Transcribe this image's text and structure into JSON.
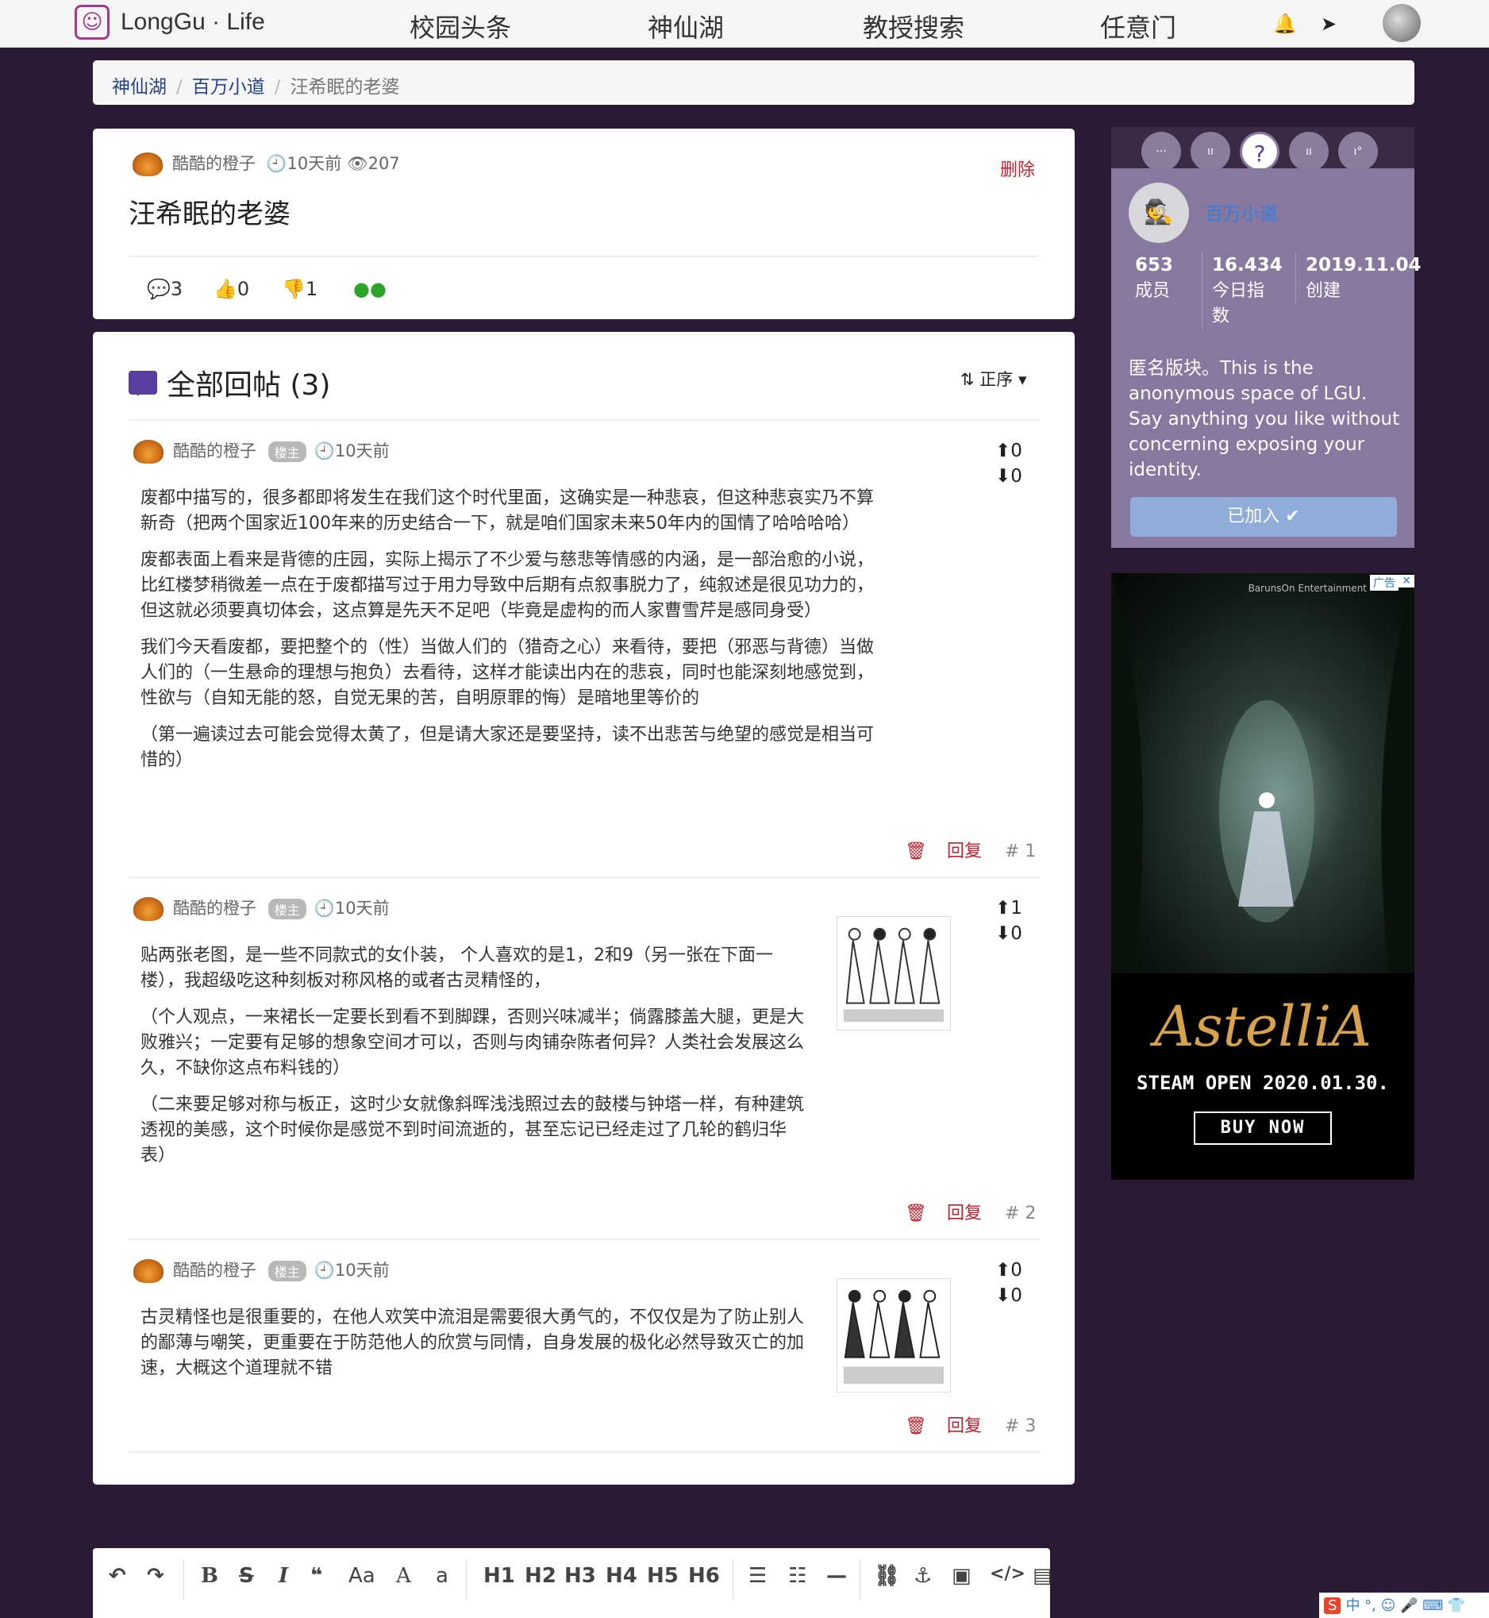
{
  "nav": {
    "logo_text": "LongGu · Life",
    "links": [
      "校园头条",
      "神仙湖",
      "教授搜索",
      "任意门"
    ]
  },
  "breadcrumb": [
    "神仙湖",
    "百万小道",
    "汪希眠的老婆"
  ],
  "post": {
    "author": "酷酷的橙子",
    "time": "10天前",
    "views": "207",
    "delete_label": "删除",
    "title": "汪希眠的老婆",
    "comments": "3",
    "likes": "0",
    "dislikes": "1"
  },
  "replies": {
    "header": "全部回帖 (3)",
    "sort_label": "正序",
    "items": [
      {
        "author": "酷酷的橙子",
        "tag": "楼主",
        "time": "10天前",
        "up": "0",
        "down": "0",
        "paragraphs": [
          "废都中描写的，很多都即将发生在我们这个时代里面，这确实是一种悲哀，但这种悲哀实乃不算新奇（把两个国家近100年来的历史结合一下，就是咱们国家未来50年内的国情了哈哈哈哈）",
          "废都表面上看来是背德的庄园，实际上揭示了不少爱与慈悲等情感的内涵，是一部治愈的小说，比红楼梦稍微差一点在于废都描写过于用力导致中后期有点叙事脱力了，纯叙述是很见功力的，但这就必须要真切体会，这点算是先天不足吧（毕竟是虚构的而人家曹雪芹是感同身受）",
          "我们今天看废都，要把整个的（性）当做人们的（猎奇之心）来看待，要把（邪恶与背德）当做人们的（一生悬命的理想与抱负）去看待，这样才能读出内在的悲哀，同时也能深刻地感觉到，性欲与（自知无能的怒，自觉无果的苦，自明原罪的悔）是暗地里等价的",
          "（第一遍读过去可能会觉得太黄了，但是请大家还是要坚持，读不出悲苦与绝望的感觉是相当可惜的）"
        ],
        "reply_label": "回复",
        "floor": "# 1"
      },
      {
        "author": "酷酷的橙子",
        "tag": "楼主",
        "time": "10天前",
        "up": "1",
        "down": "0",
        "paragraphs": [
          "贴两张老图，是一些不同款式的女仆装， 个人喜欢的是1，2和9（另一张在下面一楼），我超级吃这种刻板对称风格的或者古灵精怪的，",
          "（个人观点，一来裙长一定要长到看不到脚踝，否则兴味减半；倘露膝盖大腿，更是大败雅兴；一定要有足够的想象空间才可以，否则与肉铺杂陈者何异？人类社会发展这么久，不缺你这点布料钱的）",
          "（二来要足够对称与板正，这时少女就像斜晖浅浅照过去的鼓楼与钟塔一样，有种建筑透视的美感，这个时候你是感觉不到时间流逝的，甚至忘记已经走过了几轮的鹤归华表）"
        ],
        "reply_label": "回复",
        "floor": "# 2"
      },
      {
        "author": "酷酷的橙子",
        "tag": "楼主",
        "time": "10天前",
        "up": "0",
        "down": "0",
        "paragraphs": [
          "古灵精怪也是很重要的，在他人欢笑中流泪是需要很大勇气的，不仅仅是为了防止别人的鄙薄与嘲笑，更重要在于防范他人的欣赏与同情，自身发展的极化必然导致灭亡的加速，大概这个道理就不错"
        ],
        "reply_label": "回复",
        "floor": "# 3"
      }
    ]
  },
  "sidebar": {
    "board_name": "百万小道",
    "members_value": "653",
    "members_label": "成员",
    "index_value": "16.434",
    "index_label": "今日指数",
    "created_value": "2019.11.04",
    "created_label": "创建",
    "description": "匿名版块。This is the anonymous space of LGU. Say anything you like without concerning exposing your identity.",
    "joined_label": "已加入 ✔"
  },
  "ad": {
    "badge": "广告",
    "close": "✕",
    "maker": "BarunsOn Entertainment",
    "brand": "AstelliA",
    "date": "STEAM OPEN 2020.01.30.",
    "buy": "BUY NOW"
  },
  "editor": {
    "headings": [
      "H1",
      "H2",
      "H3",
      "H4",
      "H5",
      "H6"
    ]
  },
  "ime": "中 °, ☺ 🎤 ⌨ 👕"
}
